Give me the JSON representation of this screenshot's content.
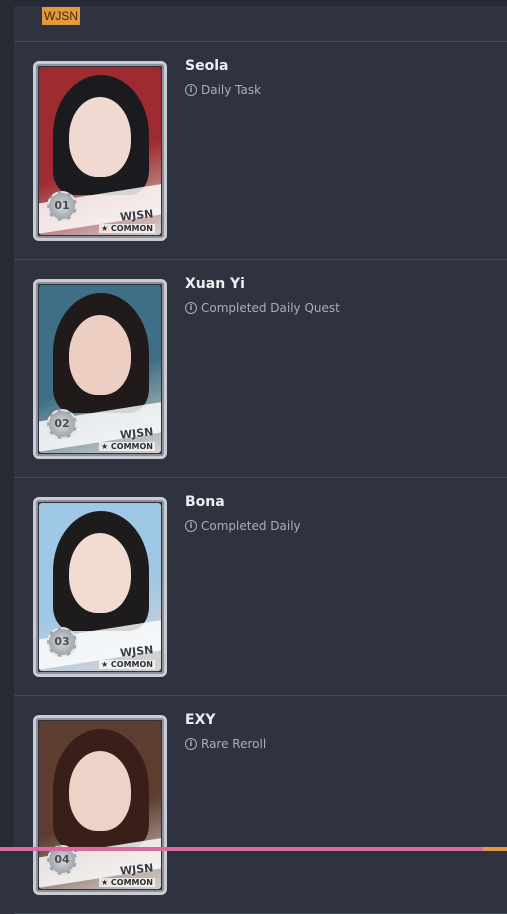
{
  "header": {
    "tag": "WJSN"
  },
  "cards": [
    {
      "name": "Seola",
      "task": "Daily Task",
      "number": "01",
      "group": "WJSN",
      "rarity": "★ COMMON",
      "colors": {
        "bg": "#9e2b2f",
        "hair": "#1b1a1f",
        "skin": "#f0d9d0"
      }
    },
    {
      "name": "Xuan Yi",
      "task": "Completed Daily Quest",
      "number": "02",
      "group": "WJSN",
      "rarity": "★ COMMON",
      "colors": {
        "bg": "#3f6f86",
        "hair": "#201a1a",
        "skin": "#eccfc2"
      }
    },
    {
      "name": "Bona",
      "task": "Completed Daily",
      "number": "03",
      "group": "WJSN",
      "rarity": "★ COMMON",
      "colors": {
        "bg": "#9fc8e6",
        "hair": "#1e1b1d",
        "skin": "#f2dbd1"
      }
    },
    {
      "name": "EXY",
      "task": "Rare Reroll",
      "number": "04",
      "group": "WJSN",
      "rarity": "★ COMMON",
      "colors": {
        "bg": "#5d3d2f",
        "hair": "#3a1e19",
        "skin": "#efd2c7"
      }
    }
  ]
}
